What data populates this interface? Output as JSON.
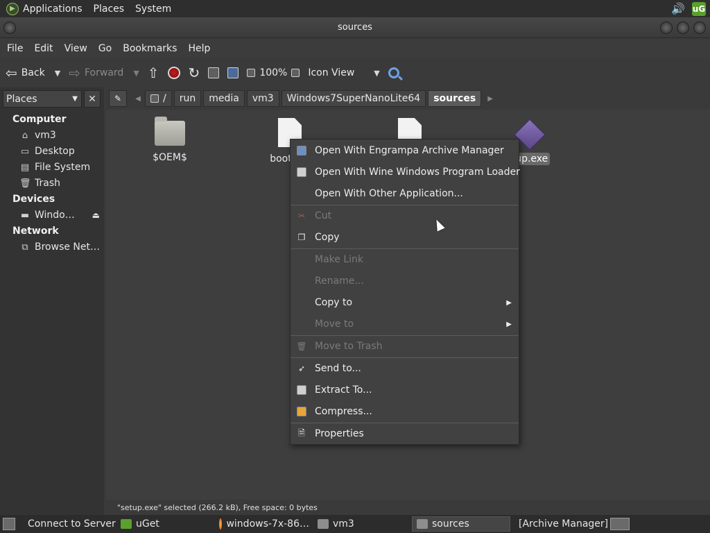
{
  "top_panel": {
    "menus": [
      "Applications",
      "Places",
      "System"
    ],
    "tray": {
      "volume_icon": "speaker-icon",
      "uget_label": "uG"
    }
  },
  "window": {
    "title": "sources"
  },
  "menubar": [
    "File",
    "Edit",
    "View",
    "Go",
    "Bookmarks",
    "Help"
  ],
  "toolbar": {
    "back_label": "Back",
    "forward_label": "Forward",
    "zoom": "100%",
    "view_mode": "Icon View"
  },
  "sidebar": {
    "combo_label": "Places",
    "sections": {
      "computer": "Computer",
      "devices": "Devices",
      "network": "Network"
    },
    "computer_items": [
      "vm3",
      "Desktop",
      "File System",
      "Trash"
    ],
    "device_items": [
      "Windo…"
    ],
    "network_items": [
      "Browse Net…"
    ]
  },
  "location": {
    "crumbs": [
      "/",
      "run",
      "media",
      "vm3",
      "Windows7SuperNanoLite64",
      "sources"
    ]
  },
  "files": [
    {
      "name": "$OEM$",
      "type": "folder"
    },
    {
      "name": "boot",
      "type": "document"
    },
    {
      "name": "",
      "type": "document"
    },
    {
      "name": "tup.exe",
      "type": "exe",
      "selected": true
    }
  ],
  "context_menu": {
    "items": [
      {
        "label": "Open With Engrampa Archive Manager",
        "enabled": true
      },
      {
        "label": "Open With Wine Windows Program Loader",
        "enabled": true
      },
      {
        "label": "Open With Other Application...",
        "enabled": true
      },
      {
        "label": "Cut",
        "enabled": false
      },
      {
        "label": "Copy",
        "enabled": true
      },
      {
        "label": "Make Link",
        "enabled": false
      },
      {
        "label": "Rename...",
        "enabled": false
      },
      {
        "label": "Copy to",
        "enabled": true
      },
      {
        "label": "Move to",
        "enabled": false
      },
      {
        "label": "Move to Trash",
        "enabled": false
      },
      {
        "label": "Send to...",
        "enabled": true
      },
      {
        "label": "Extract To...",
        "enabled": true
      },
      {
        "label": "Compress...",
        "enabled": true
      },
      {
        "label": "Properties",
        "enabled": true
      }
    ]
  },
  "status": "\"setup.exe\" selected (266.2 kB), Free space: 0 bytes",
  "taskbar": {
    "tasks": [
      "Connect to Server",
      "uGet",
      "windows-7x-86…",
      "vm3",
      "sources",
      "[Archive Manager]"
    ]
  },
  "colors": {
    "accent": "#6fa2e6",
    "stop": "#c21f1f",
    "uget": "#5aa02c"
  }
}
